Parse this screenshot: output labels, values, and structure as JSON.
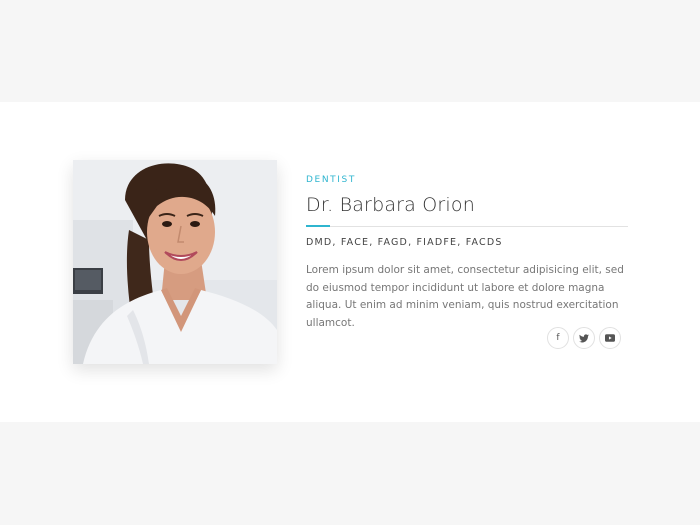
{
  "profile": {
    "role": "DENTIST",
    "name": "Dr. Barbara Orion",
    "credentials": "DMD, FACE, FAGD, FIADFE, FACDS",
    "bio": "Lorem ipsum dolor sit amet, consectetur adipisicing elit, sed do eiusmod tempor incididunt ut labore et dolore magna aliqua. Ut enim ad minim veniam, quis nostrud exercitation ullamcot."
  },
  "social": {
    "facebook_label": "f"
  },
  "colors": {
    "accent": "#2fb5cf",
    "page_bg": "#f6f6f6",
    "card_bg": "#ffffff"
  },
  "icons": [
    "facebook-icon",
    "twitter-icon",
    "youtube-icon"
  ]
}
